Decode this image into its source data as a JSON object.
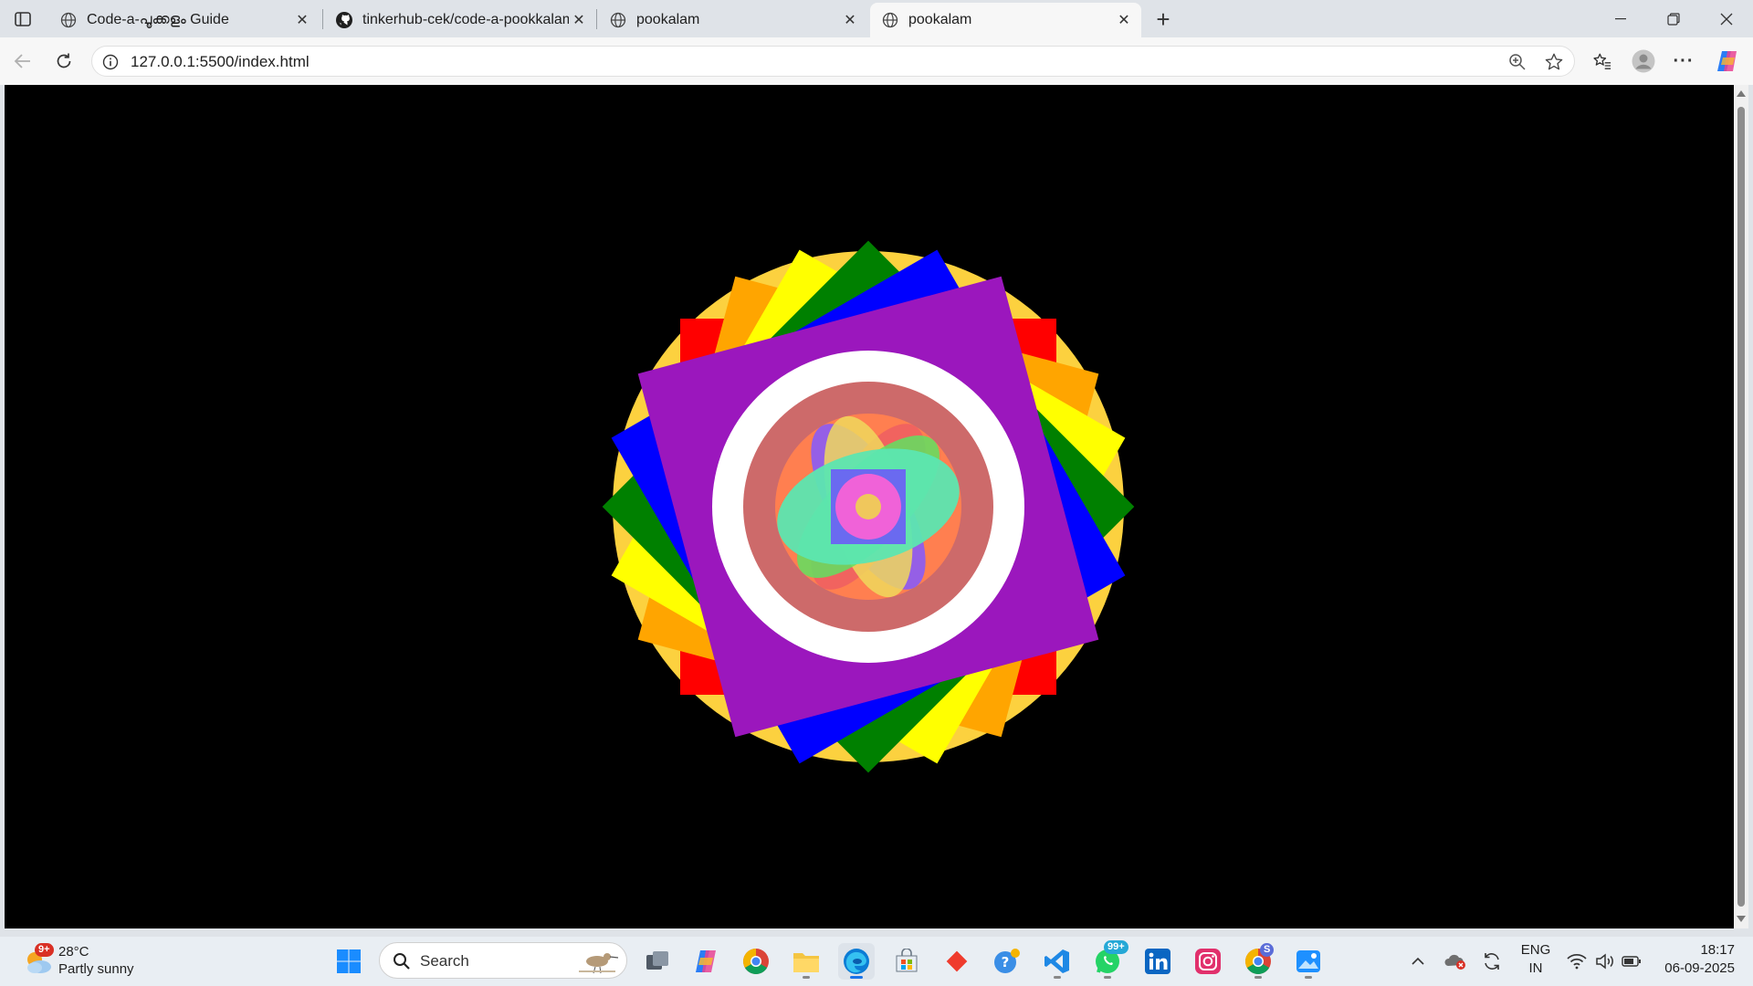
{
  "browser": {
    "tabs": [
      {
        "label": "Code-a-പൂക്കളം Guide"
      },
      {
        "label": "tinkerhub-cek/code-a-pookkalam"
      },
      {
        "label": "pookalam"
      },
      {
        "label": "pookalam"
      }
    ],
    "url": "127.0.0.1:5500/index.html"
  },
  "taskbar": {
    "weather_badge": "9+",
    "temperature": "28°C",
    "condition": "Partly sunny",
    "search_label": "Search",
    "whatsapp_badge": "99+",
    "chrome_badge": "S",
    "language_line1": "ENG",
    "language_line2": "IN",
    "time": "18:17",
    "date": "06-09-2025"
  },
  "colors": {
    "ring_yellow": "#fcd13f",
    "square_red": "#ff0000",
    "square_orange": "#ffa500",
    "square_yellow": "#ffff00",
    "square_green": "#008000",
    "square_blue": "#0000ff",
    "square_purple": "#9b17bd",
    "inner_white": "#ffffff",
    "salmon_ring": "#cd6a6a",
    "petal_orange": "#ff7f50",
    "petal_violet": "#8a5cf6",
    "petal_red": "#f06060",
    "petal_yellow": "#f0d85c",
    "petal_green": "#60e060",
    "petal_mint": "#5ce6b0",
    "center_square": "#6a6af0",
    "center_pink": "#f062d8",
    "center_yellow": "#f0c75c"
  }
}
